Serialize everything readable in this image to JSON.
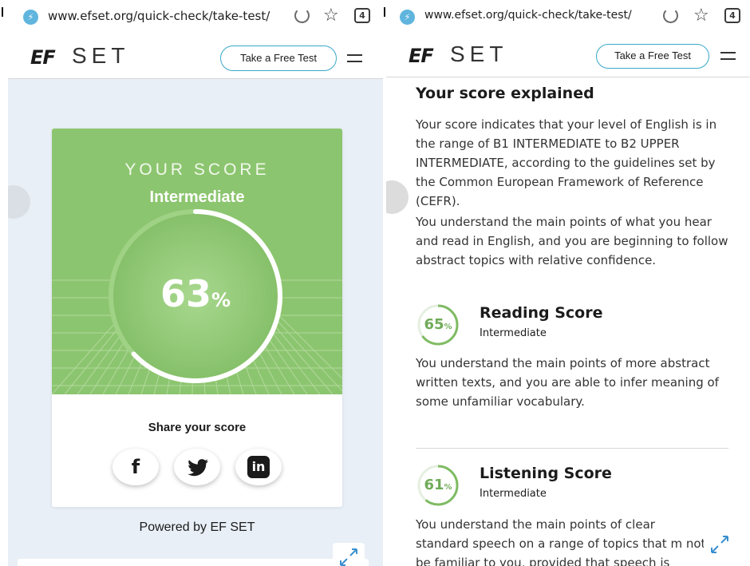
{
  "colors": {
    "accent_green": "#8cc56f",
    "button_border": "#3aa8c8",
    "panel_bg": "#e9eff6"
  },
  "browser": {
    "url": "www.efset.org/quick-check/take-test/",
    "tab_count": "4",
    "icons": [
      "secure-shield-icon",
      "reload-icon",
      "bookmark-star-icon",
      "tabs-count-icon"
    ]
  },
  "header": {
    "logo_ef": "EF",
    "logo_set": "SET",
    "cta_label": "Take a Free Test",
    "menu_icon": "hamburger-menu-icon"
  },
  "result_card": {
    "title": "YOUR SCORE",
    "level": "Intermediate",
    "score_value": "63",
    "score_unit": "%",
    "score_fraction": 0.63,
    "share_title": "Share your score",
    "share_icons": [
      "facebook-icon",
      "twitter-icon",
      "linkedin-icon"
    ],
    "facebook_glyph": "f",
    "twitter_glyph": "🐦",
    "linkedin_glyph": "in"
  },
  "powered_by": "Powered by EF SET",
  "explanation": {
    "heading": "Your score explained",
    "paragraph_1": "Your score indicates that your level of English is in the range of B1 INTERMEDIATE to B2 UPPER INTERMEDIATE, according to the guidelines set by the Common European Framework of Reference (CEFR).",
    "paragraph_2": "You understand the main points of what you hear and read in English, and you are beginning to follow abstract topics with relative confidence.",
    "reading": {
      "title": "Reading Score",
      "level": "Intermediate",
      "value": "65",
      "unit": "%",
      "fraction": 0.65,
      "description": "You understand the main points of more abstract written texts, and you are able to infer meaning of some unfamiliar vocabulary."
    },
    "listening": {
      "title": "Listening Score",
      "level": "Intermediate",
      "value": "61",
      "unit": "%",
      "fraction": 0.61,
      "description": "You understand the main points of clear standard speech on a range of topics that m not be familiar to you, provided that speech is"
    }
  }
}
